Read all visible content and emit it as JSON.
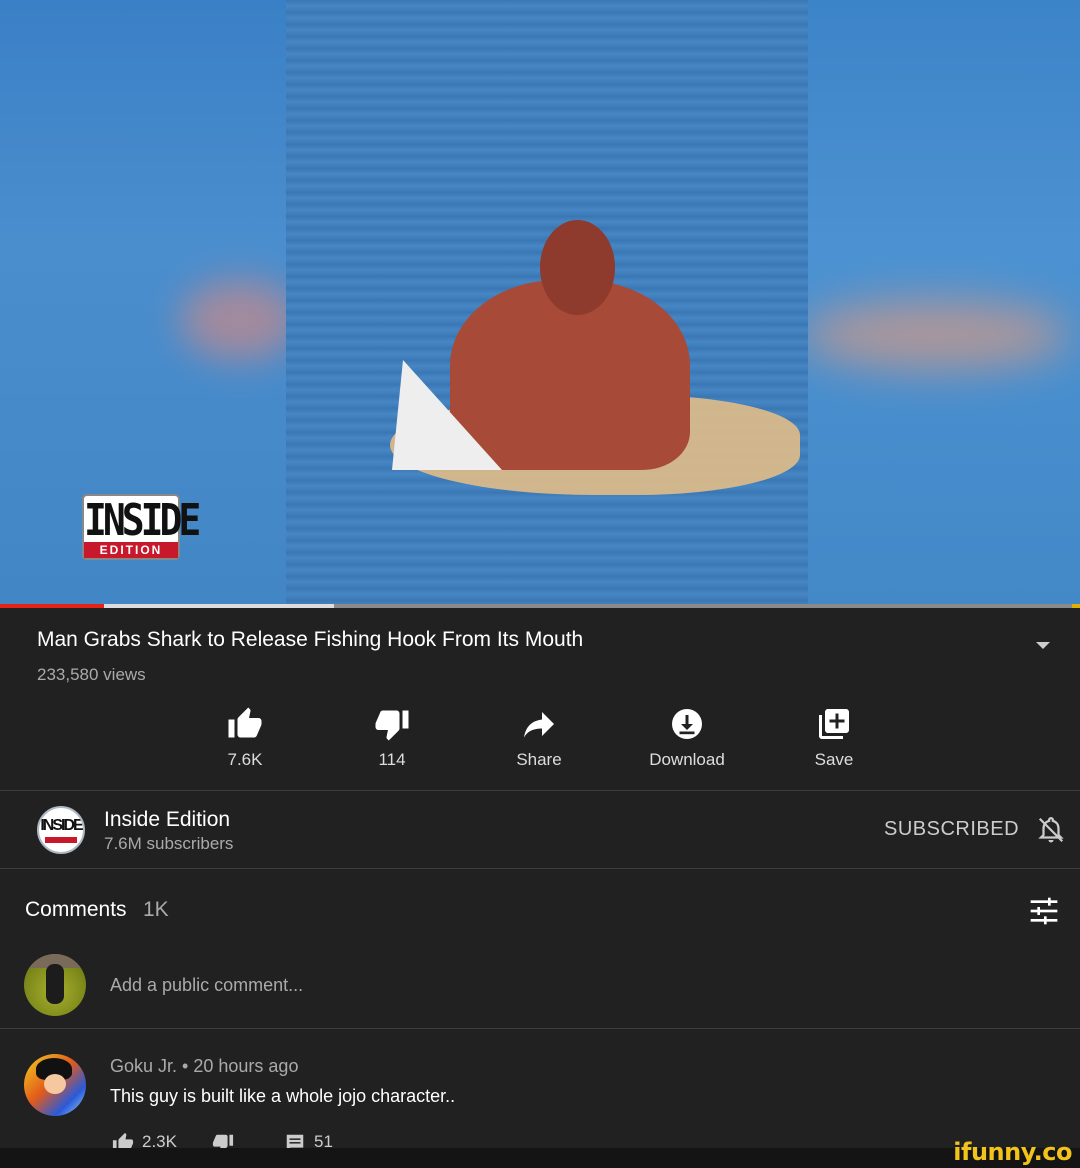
{
  "video": {
    "watermark_logo": {
      "line1": "INSIDE",
      "line2": "EDITION"
    },
    "progress_played_fraction": 0.096,
    "progress_buffered_fraction": 0.309
  },
  "meta": {
    "title": "Man Grabs Shark to Release Fishing Hook From Its Mouth",
    "views": "233,580 views"
  },
  "actions": [
    {
      "icon": "thumb-up-icon",
      "label": "7.6K"
    },
    {
      "icon": "thumb-down-icon",
      "label": "114"
    },
    {
      "icon": "share-icon",
      "label": "Share"
    },
    {
      "icon": "download-icon",
      "label": "Download"
    },
    {
      "icon": "save-playlist-icon",
      "label": "Save"
    }
  ],
  "channel": {
    "name": "Inside Edition",
    "subscribers": "7.6M subscribers",
    "subscribe_state": "SUBSCRIBED"
  },
  "comments": {
    "header": "Comments",
    "count": "1K",
    "add_placeholder": "Add a public comment...",
    "items": [
      {
        "author": "Goku Jr.",
        "separator": "•",
        "time": "20 hours ago",
        "text": "This guy is built like a whole jojo character..",
        "likes": "2.3K",
        "replies": "51"
      }
    ]
  },
  "watermark_site": "ifunny.co",
  "colors": {
    "background": "#212121",
    "progress_played": "#e62117",
    "ifunny_yellow": "#f2c31a"
  }
}
